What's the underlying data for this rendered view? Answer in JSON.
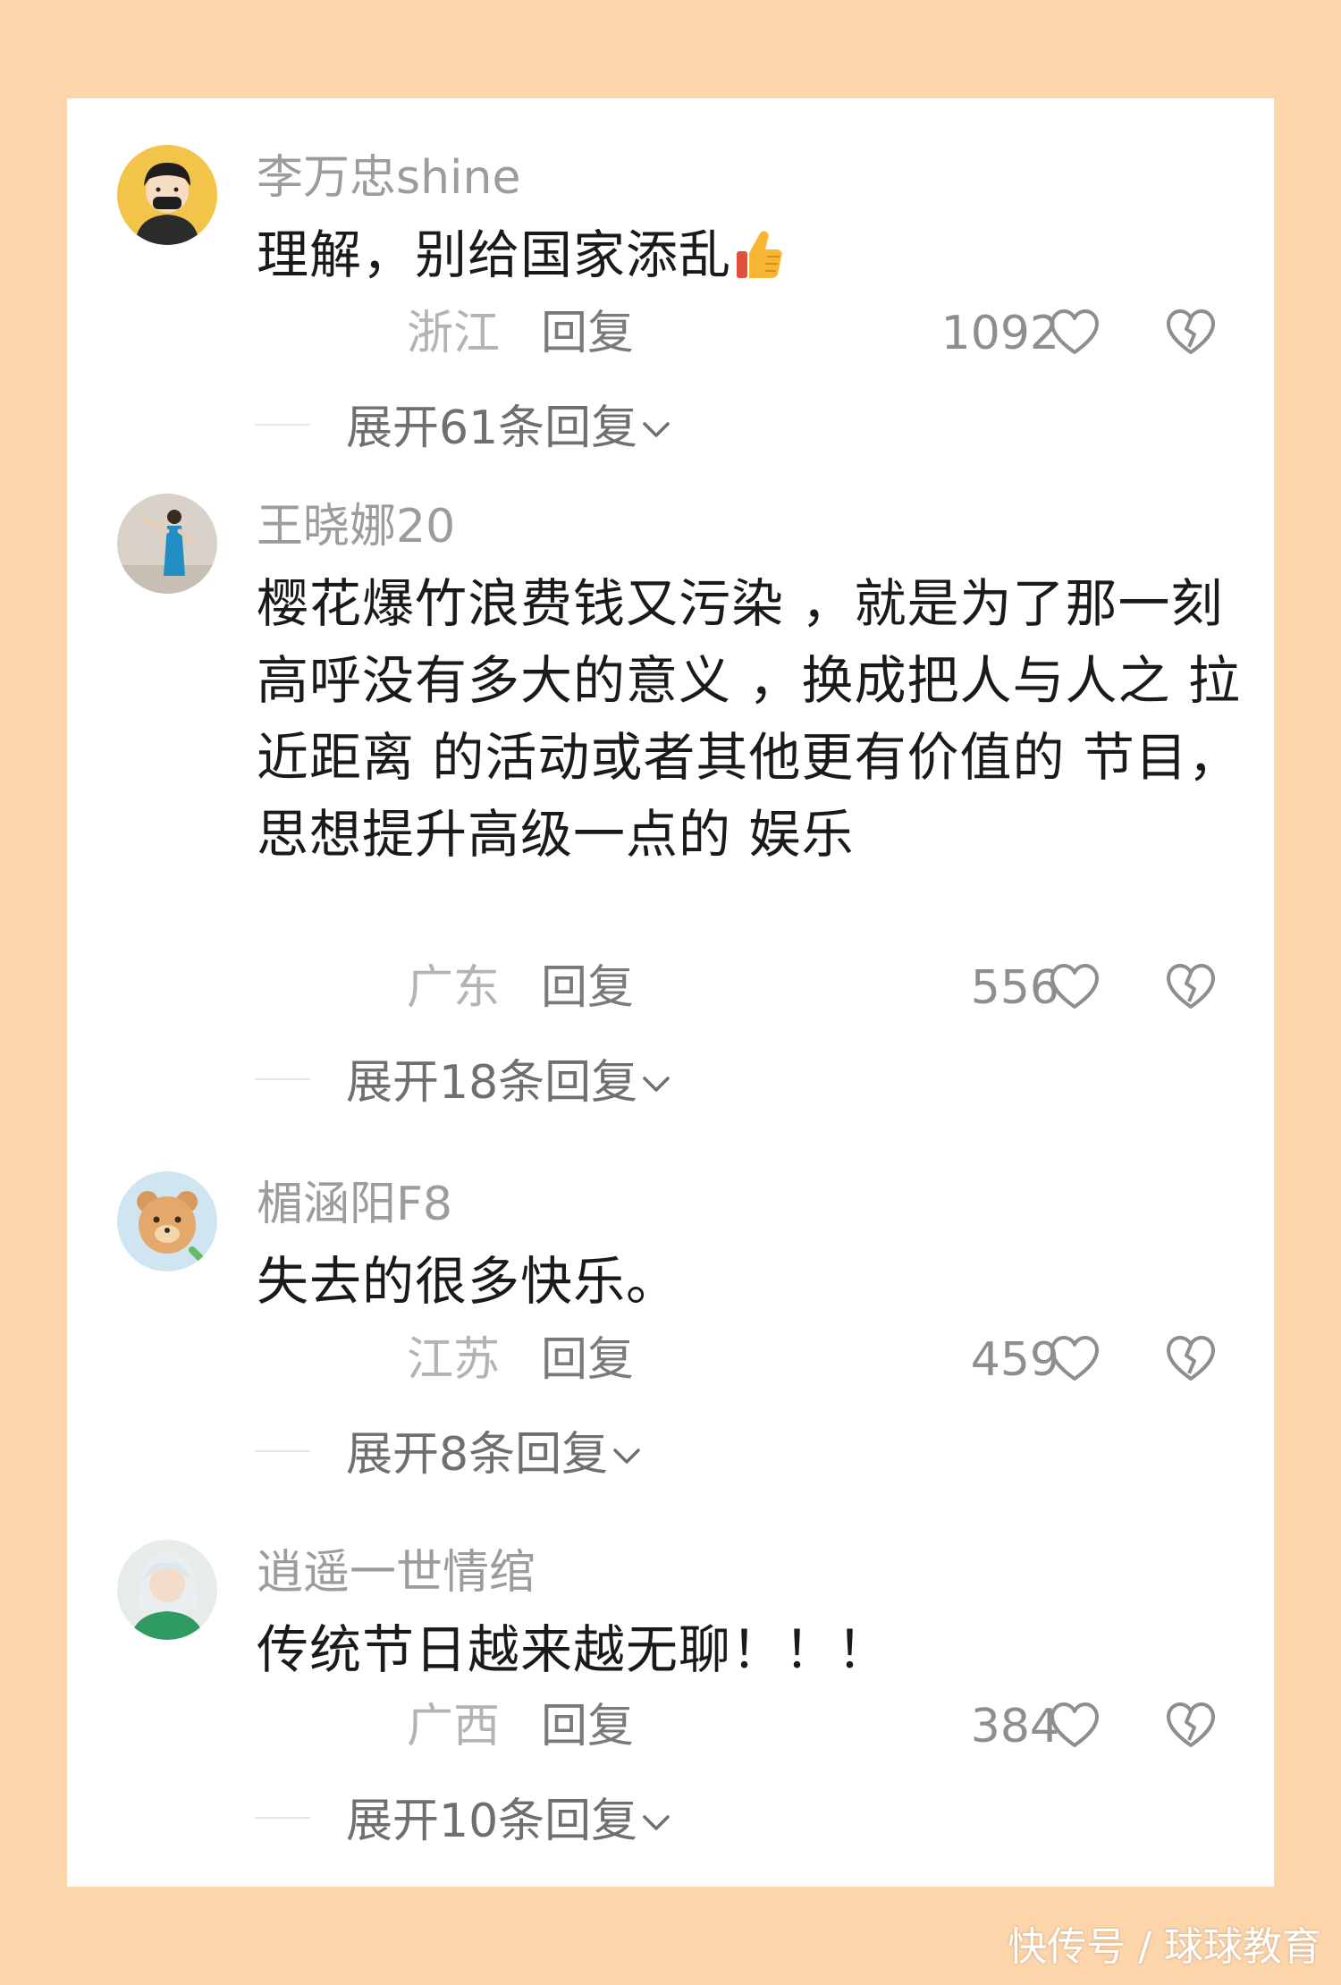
{
  "comments": [
    {
      "username": "李万忠shine",
      "text": "理解，别给国家添乱",
      "location": "浙江",
      "reply_label": "回复",
      "likes": "1092",
      "expand_label": "展开61条回复"
    },
    {
      "username": "王晓娜20",
      "text": "樱花爆竹浪费钱又污染 ，就是为了那一刻高呼没有多大的意义 ，换成把人与人之 拉近距离 的活动或者其他更有价值的 节目，思想提升高级一点的 娱乐",
      "location": "广东",
      "reply_label": "回复",
      "likes": "556",
      "expand_label": "展开18条回复"
    },
    {
      "username": "楣涵阳F8",
      "text": "失去的很多快乐。",
      "location": "江苏",
      "reply_label": "回复",
      "likes": "459",
      "expand_label": "展开8条回复"
    },
    {
      "username": "逍遥一世情绾",
      "text": "传统节日越来越无聊！！！",
      "location": "广西",
      "reply_label": "回复",
      "likes": "384",
      "expand_label": "展开10条回复"
    }
  ],
  "watermark": "快传号 / 球球教育",
  "colors": {
    "page_background": "#fdd5ab",
    "card_background": "#ffffff",
    "username": "#9c9c9c",
    "text": "#1a1a1a",
    "meta": "#8e8e8e"
  }
}
